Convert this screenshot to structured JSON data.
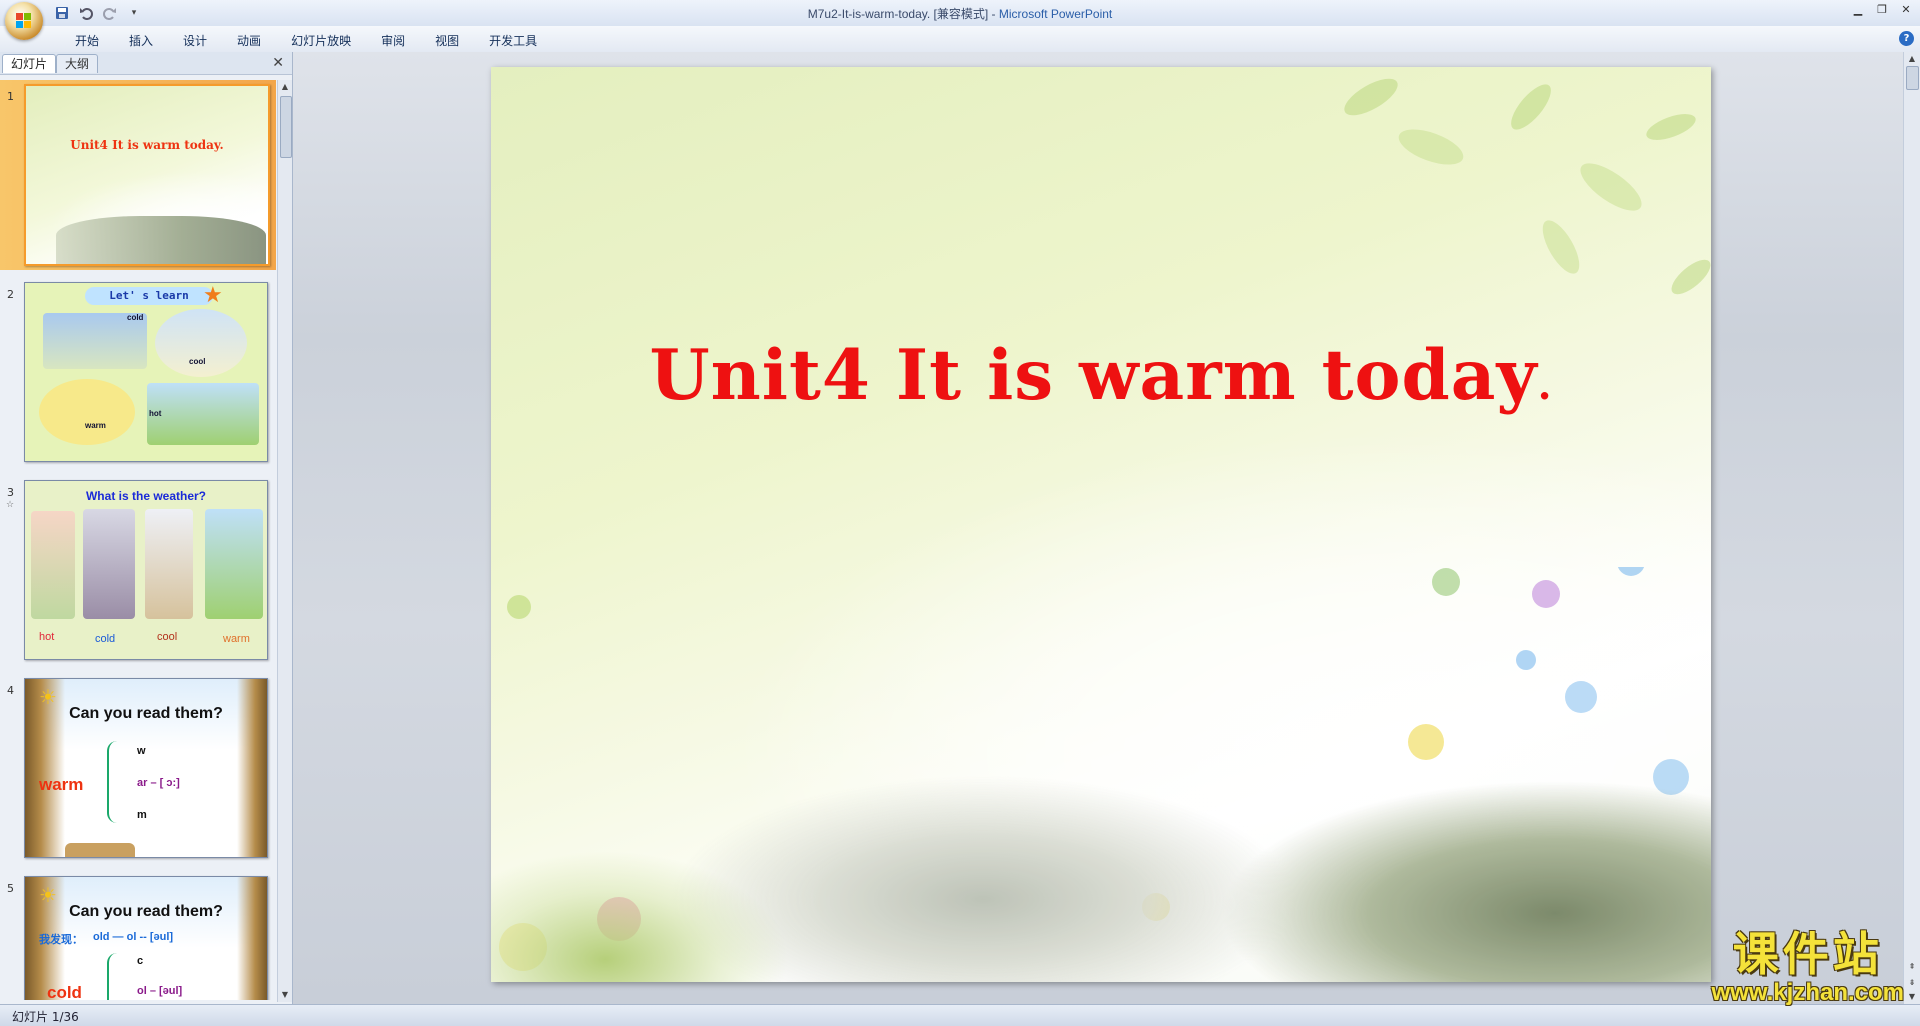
{
  "window": {
    "title_doc": "M7u2-It-is-warm-today. [兼容模式] - ",
    "title_app": "Microsoft PowerPoint"
  },
  "ribbon": {
    "tabs": [
      "开始",
      "插入",
      "设计",
      "动画",
      "幻灯片放映",
      "审阅",
      "视图",
      "开发工具"
    ]
  },
  "panel": {
    "tab_slides": "幻灯片",
    "tab_outline": "大纲"
  },
  "thumbnails": [
    {
      "num": "1",
      "title": "Unit4 It is warm today",
      "period": "."
    },
    {
      "num": "2",
      "heading": "Let' s learn",
      "labels": [
        "cold",
        "cool",
        "warm",
        "hot"
      ]
    },
    {
      "num": "3",
      "heading": "What is the weather?",
      "labels": [
        "hot",
        "cold",
        "cool",
        "warm"
      ]
    },
    {
      "num": "4",
      "heading": "Can you read them?",
      "word": "warm",
      "parts": [
        "w",
        "ar – [ ɔ:]",
        "m"
      ]
    },
    {
      "num": "5",
      "heading": "Can you read them?",
      "discover": "我发现：",
      "rule_old": "old — ol -- [əul]",
      "word": "cold",
      "parts": [
        "c",
        "ol – [əul]"
      ]
    }
  ],
  "slide": {
    "title": "Unit4 It is warm today",
    "period": "."
  },
  "status": {
    "text": "幻灯片 1/36"
  },
  "watermark": {
    "cn": "课件站",
    "url": "www.kjzhan.com"
  },
  "colors": {
    "title_red": "#ee1111",
    "selection_orange": "#f59b2b",
    "watermark_yellow": "#f4e23a"
  }
}
